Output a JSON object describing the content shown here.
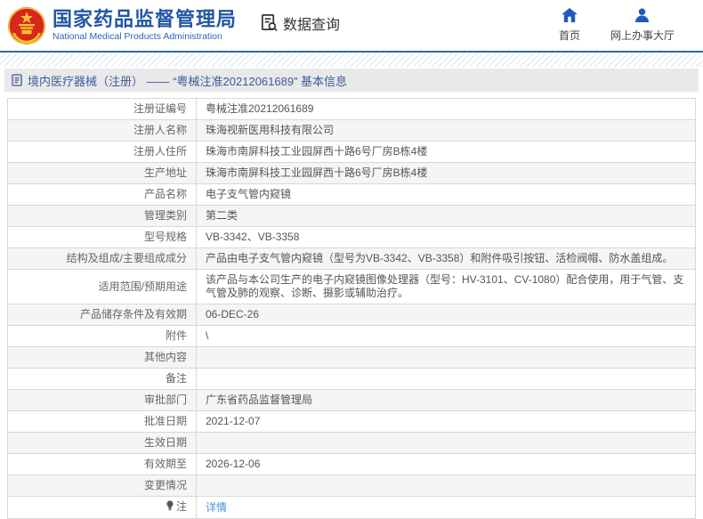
{
  "header": {
    "agency_cn": "国家药品监督管理局",
    "agency_en": "National Medical Products Administration",
    "section_label": "数据查询",
    "nav_home": "首页",
    "nav_hall": "网上办事大厅"
  },
  "breadcrumb": {
    "title": "境内医疗器械（注册） —— “粤械注准20212061689” 基本信息"
  },
  "colors": {
    "accent_blue": "#2257a5",
    "nav_icon_blue": "#1f5bbf",
    "link_blue": "#4a90d9",
    "emblem_red": "#d8261c",
    "emblem_gold": "#f7c430",
    "divider_blue": "#2e6da4"
  },
  "table": {
    "rows": [
      {
        "label": "注册证编号",
        "value": "粤械注准20212061689"
      },
      {
        "label": "注册人名称",
        "value": "珠海视新医用科技有限公司"
      },
      {
        "label": "注册人住所",
        "value": "珠海市南屏科技工业园屏西十路6号厂房B栋4楼"
      },
      {
        "label": "生产地址",
        "value": "珠海市南屏科技工业园屏西十路6号厂房B栋4楼"
      },
      {
        "label": "产品名称",
        "value": "电子支气管内窥镜"
      },
      {
        "label": "管理类别",
        "value": "第二类"
      },
      {
        "label": "型号规格",
        "value": "VB-3342、VB-3358"
      },
      {
        "label": "结构及组成/主要组成成分",
        "value": "产品由电子支气管内窥镜（型号为VB-3342、VB-3358）和附件吸引按钮、活检阀帽、防水盖组成。"
      },
      {
        "label": "适用范围/预期用途",
        "value": "该产品与本公司生产的电子内窥镜图像处理器（型号：HV-3101、CV-1080）配合使用，用于气管、支气管及肺的观察、诊断、摄影或辅助治疗。"
      },
      {
        "label": "产品储存条件及有效期",
        "value": "06-DEC-26"
      },
      {
        "label": "附件",
        "value": "\\"
      },
      {
        "label": "其他内容",
        "value": ""
      },
      {
        "label": "备注",
        "value": ""
      },
      {
        "label": "审批部门",
        "value": "广东省药品监督管理局"
      },
      {
        "label": "批准日期",
        "value": "2021-12-07"
      },
      {
        "label": "生效日期",
        "value": ""
      },
      {
        "label": "有效期至",
        "value": "2026-12-06"
      },
      {
        "label": "变更情况",
        "value": ""
      },
      {
        "label": "注",
        "value": "详情",
        "icon": "bulb",
        "link": true
      }
    ]
  }
}
